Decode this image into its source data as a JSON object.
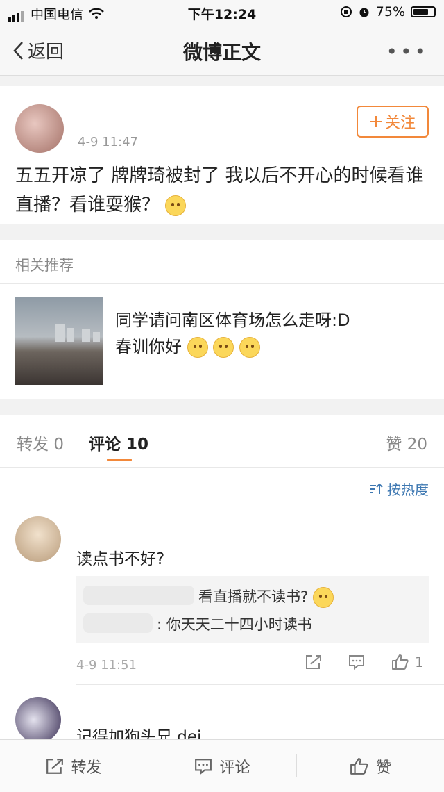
{
  "status_bar": {
    "carrier": "中国电信",
    "time": "下午12:24",
    "battery": "75%",
    "battery_level": 0.75
  },
  "nav": {
    "back_label": "返回",
    "title": "微博正文"
  },
  "post": {
    "time": "4-9 11:47",
    "follow_label": "关注",
    "text": "五五开凉了 牌牌琦被封了 我以后不开心的时候看谁直播？看谁耍猴？"
  },
  "recommend": {
    "header": "相关推荐",
    "item": {
      "line1": "同学请问南区体育场怎么走呀:D",
      "line2": "春训你好"
    }
  },
  "tabs": {
    "repost": "转发",
    "repost_count": "0",
    "comment": "评论",
    "comment_count": "10",
    "like": "赞",
    "like_count": "20"
  },
  "comments": {
    "sort_label": "按热度",
    "items": [
      {
        "text": "读点书不好?",
        "reply1": "看直播就不读书?",
        "reply2": ": 你天天二十四小时读书",
        "time": "4-9 11:51",
        "like_count": "1"
      },
      {
        "text": "记得加狗头兄.dei"
      }
    ]
  },
  "bottom_bar": {
    "repost": "转发",
    "comment": "评论",
    "like": "赞"
  },
  "colors": {
    "accent": "#f2883a",
    "link": "#3e78b2"
  }
}
